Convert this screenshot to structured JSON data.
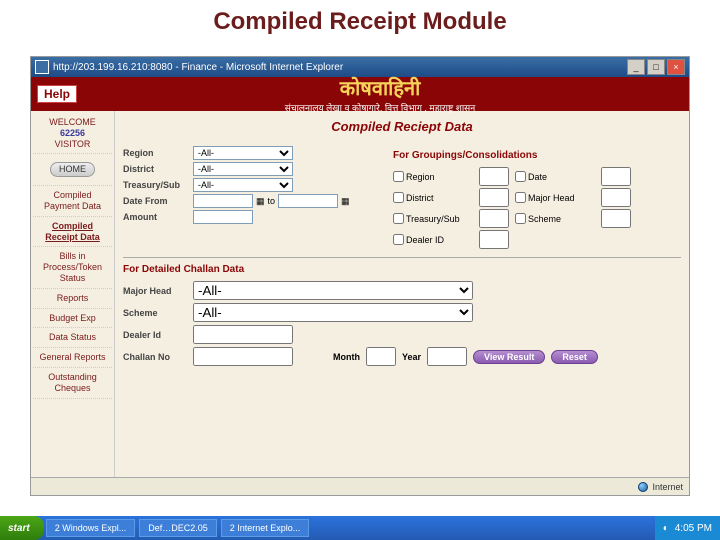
{
  "slide": {
    "title": "Compiled Receipt Module"
  },
  "window": {
    "title": "http://203.199.16.210:8080 - Finance - Microsoft Internet Explorer",
    "min": "_",
    "max": "□",
    "close": "×"
  },
  "banner": {
    "help": "Help",
    "brand": "कोषवाहिनी",
    "subtitle": "संचालनालय लेखा व कोषागारे, वित्त विभाग , महाराष्ट्र शासन"
  },
  "sidebar": {
    "welcome": "WELCOME",
    "visitor_num": "62256",
    "visitor": "VISITOR",
    "home": "HOME",
    "items": [
      "Compiled Payment Data",
      "Compiled Receipt Data",
      "Bills in Process/Token Status",
      "Reports",
      "Budget Exp",
      "Data Status",
      "General Reports",
      "Outstanding Cheques"
    ]
  },
  "main": {
    "heading": "Compiled Reciept Data",
    "labels": {
      "region": "Region",
      "district": "District",
      "treasury": "Treasury/Sub",
      "date_from": "Date From",
      "to": "to",
      "amount": "Amount"
    },
    "selects": {
      "region": "-All-",
      "district": "-All-",
      "treasury": "-All-",
      "major_head": "-All-",
      "scheme": "-All-"
    },
    "groupings": {
      "title": "For Groupings/Consolidations",
      "region": "Region",
      "date": "Date",
      "district": "District",
      "major_head": "Major Head",
      "treasury": "Treasury/Sub",
      "scheme": "Scheme",
      "dealer": "Dealer ID"
    },
    "detail": {
      "title": "For Detailed Challan Data",
      "major_head": "Major Head",
      "scheme": "Scheme",
      "dealer": "Dealer Id",
      "challan": "Challan No",
      "month": "Month",
      "year": "Year"
    },
    "buttons": {
      "view": "View Result",
      "reset": "Reset"
    }
  },
  "status": {
    "internet": "Internet"
  },
  "taskbar": {
    "start": "start",
    "items": [
      "2 Windows Expl...",
      "Def…DEC2.05",
      "2 Internet Explo..."
    ],
    "clock": "4:05 PM"
  }
}
